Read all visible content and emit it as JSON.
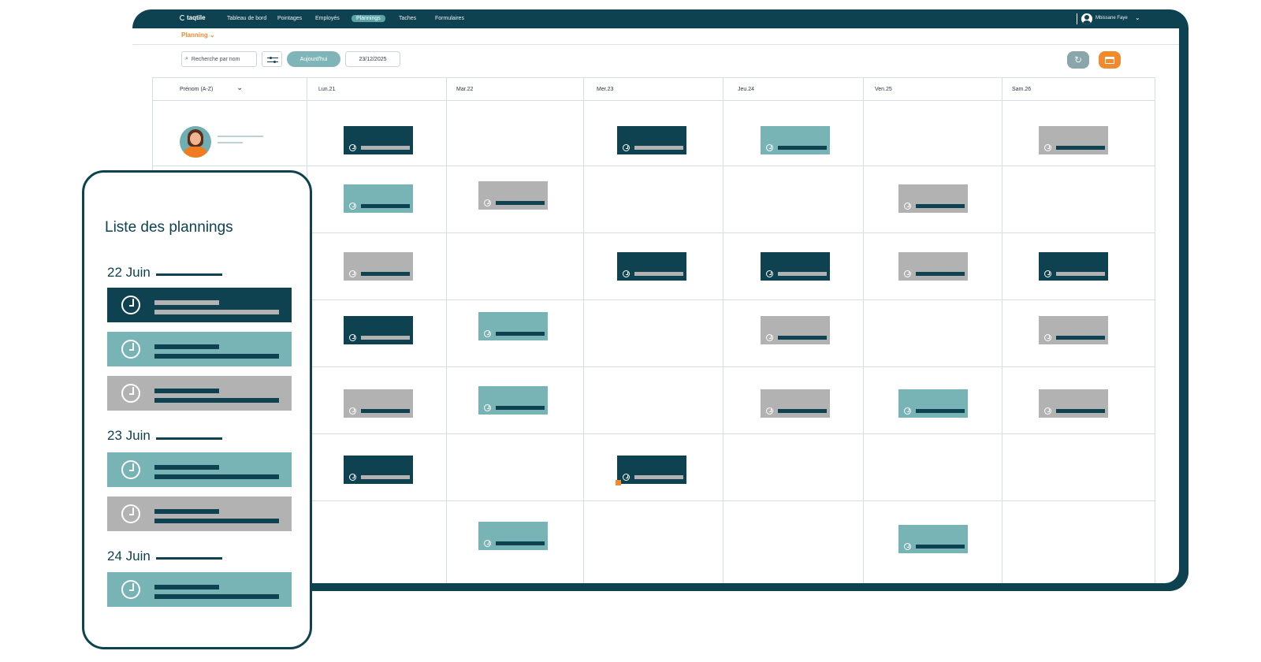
{
  "app": {
    "logo_text": "taqtile",
    "nav": [
      "Tableau de bord",
      "Pointages",
      "Employés",
      "Plannings",
      "Taches",
      "Formulaires"
    ],
    "active_nav": "Plannings",
    "user_name": "Mbissane Faye"
  },
  "breadcrumb": "Planning",
  "toolbar": {
    "search_placeholder": "Recherche par nom",
    "today_label": "Aujourd'hui",
    "date_value": "23/12/2025"
  },
  "calendar": {
    "sort_label": "Prénom (A-Z)",
    "days": [
      "Lun.21",
      "Mar.22",
      "Mer.23",
      "Jeu.24",
      "Ven.25",
      "Sam.26"
    ]
  },
  "colors": {
    "primary": "#0f4250",
    "teal": "#78b3b5",
    "gray": "#b2b2b2",
    "accent": "#f08a2c"
  },
  "mobile": {
    "title": "Liste des plannings",
    "groups": [
      {
        "date": "22 Juin",
        "cards": [
          "dark",
          "teal",
          "gray"
        ]
      },
      {
        "date": "23 Juin",
        "cards": [
          "teal",
          "gray"
        ]
      },
      {
        "date": "24 Juin",
        "cards": [
          "teal"
        ]
      }
    ]
  }
}
